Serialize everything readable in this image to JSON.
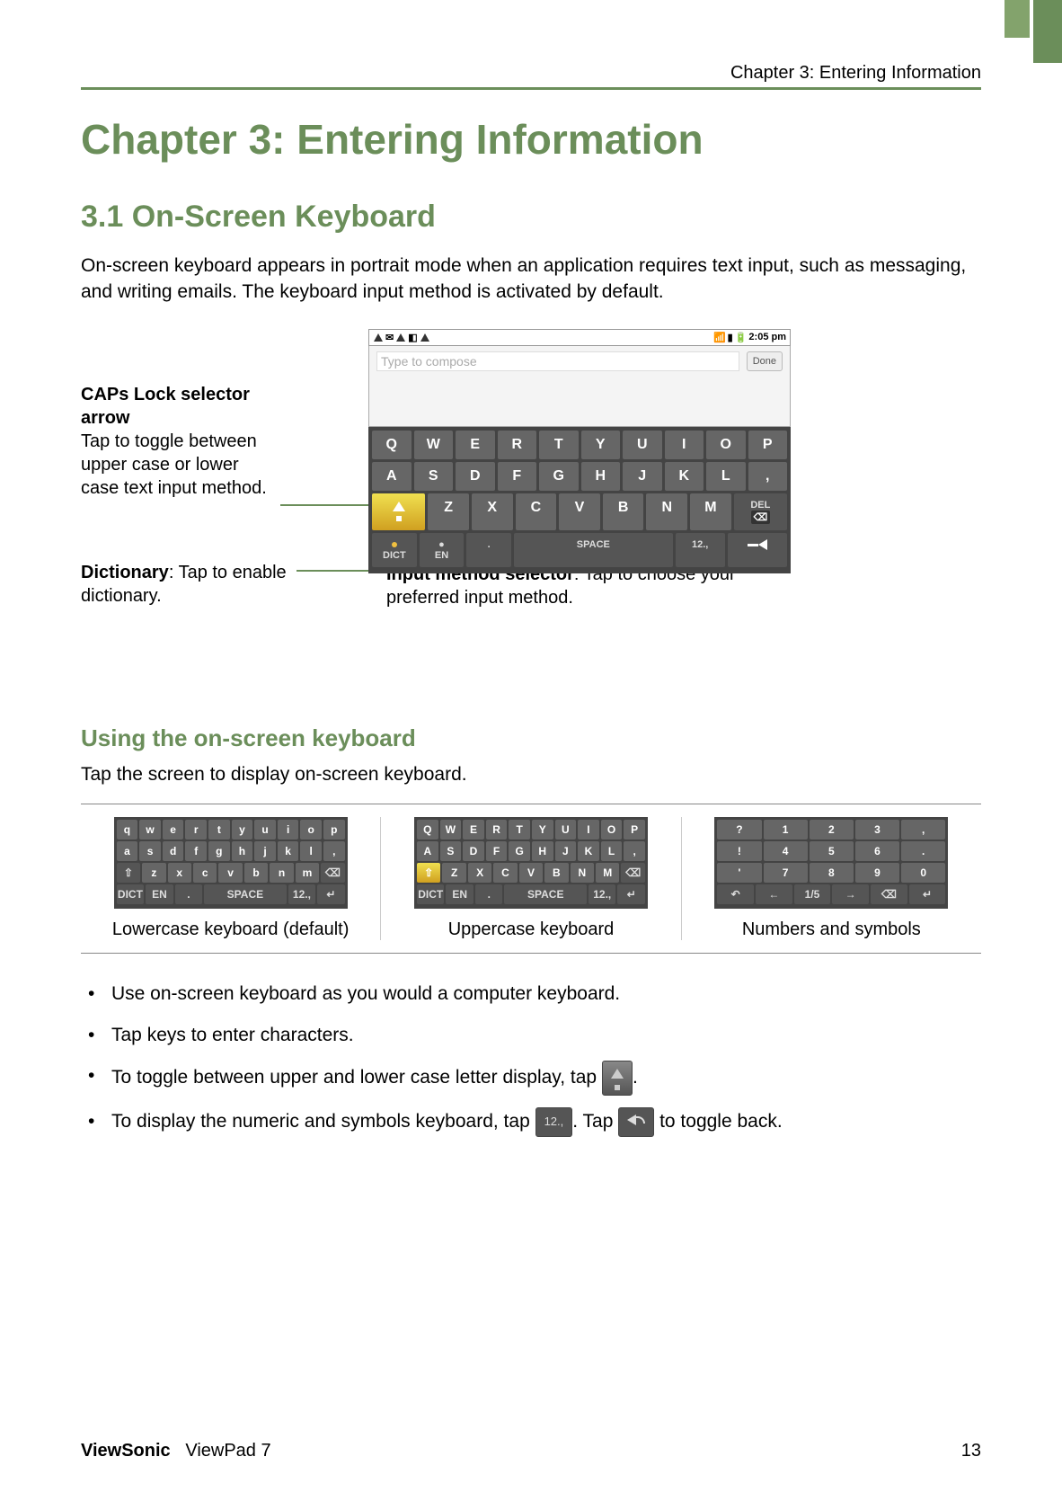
{
  "header": {
    "running": "Chapter 3: Entering Information"
  },
  "h1": "Chapter 3: Entering Information",
  "h2": "3.1 On-Screen Keyboard",
  "intro": "On-screen keyboard appears in portrait mode when an application requires text input, such as messaging, and writing emails. The keyboard input method is activated by default.",
  "callouts": {
    "caps_title": "CAPs Lock selector arrow",
    "caps_body": "Tap to toggle between upper case or lower case text input method.",
    "dict_title": "Dictionary",
    "dict_body": ": Tap to enable dictionary.",
    "ims_title": "Input method selector",
    "ims_body": ": Tap to choose your preferred input method."
  },
  "phone": {
    "time": "2:05 pm",
    "hint": "Type to compose",
    "done": "Done",
    "rows": {
      "r1": [
        "Q",
        "W",
        "E",
        "R",
        "T",
        "Y",
        "U",
        "I",
        "O",
        "P"
      ],
      "r2": [
        "A",
        "S",
        "D",
        "F",
        "G",
        "H",
        "J",
        "K",
        "L",
        ","
      ],
      "r3_letters": [
        "Z",
        "X",
        "C",
        "V",
        "B",
        "N",
        "M"
      ],
      "del_label": "DEL",
      "bottom": {
        "dict": "DICT",
        "en": "EN",
        "dot": ".",
        "space": "SPACE",
        "num": "12.,"
      }
    }
  },
  "h3": "Using the on-screen keyboard",
  "using_intro": "Tap the screen to display on-screen keyboard.",
  "kbd_variants": {
    "lower": {
      "r1": [
        "q",
        "w",
        "e",
        "r",
        "t",
        "y",
        "u",
        "i",
        "o",
        "p"
      ],
      "r2": [
        "a",
        "s",
        "d",
        "f",
        "g",
        "h",
        "j",
        "k",
        "l",
        ","
      ],
      "r3": [
        "z",
        "x",
        "c",
        "v",
        "b",
        "n",
        "m"
      ],
      "caption": "Lowercase keyboard (default)"
    },
    "upper": {
      "r1": [
        "Q",
        "W",
        "E",
        "R",
        "T",
        "Y",
        "U",
        "I",
        "O",
        "P"
      ],
      "r2": [
        "A",
        "S",
        "D",
        "F",
        "G",
        "H",
        "J",
        "K",
        "L",
        ","
      ],
      "r3": [
        "Z",
        "X",
        "C",
        "V",
        "B",
        "N",
        "M"
      ],
      "caption": "Uppercase keyboard"
    },
    "nums": {
      "r1": [
        "?",
        "1",
        "2",
        "3",
        ","
      ],
      "r2": [
        "!",
        "4",
        "5",
        "6",
        "."
      ],
      "r3": [
        "'",
        "7",
        "8",
        "9",
        "0"
      ],
      "page": "1/5",
      "caption": "Numbers and symbols"
    }
  },
  "bullets": {
    "b1": "Use on-screen keyboard as you would a computer keyboard.",
    "b2": "Tap keys to enter characters.",
    "b3a": "To toggle between upper and lower case letter display, tap ",
    "b3b": ".",
    "b4a": "To display the numeric and symbols keyboard, tap ",
    "b4b": ". Tap ",
    "b4c": " to toggle back.",
    "num_label": "12.,"
  },
  "footer": {
    "brand": "ViewSonic",
    "product": "ViewPad 7",
    "page": "13"
  }
}
